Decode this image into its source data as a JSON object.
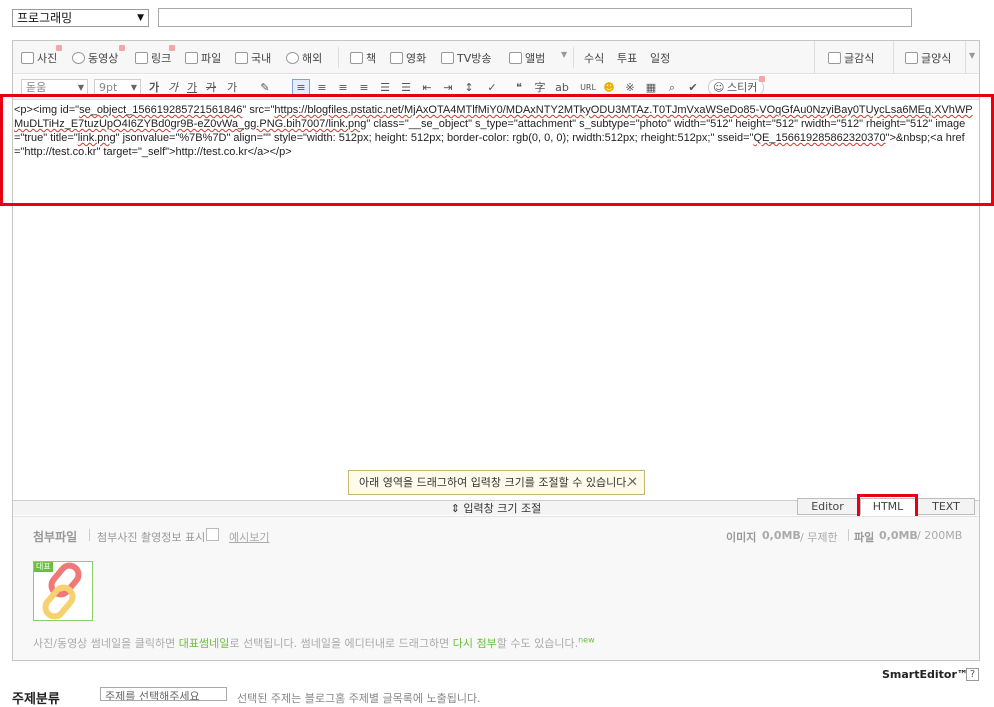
{
  "category": {
    "selected": "프로그래밍"
  },
  "title_input": {
    "value": ""
  },
  "toolbar1": {
    "photo": "사진",
    "video": "동영상",
    "link": "링크",
    "file": "파일",
    "domestic": "국내",
    "overseas": "해외",
    "book": "책",
    "movie": "영화",
    "tv": "TV방송",
    "album": "앨범",
    "formula": "수식",
    "vote": "투표",
    "schedule": "일정",
    "quote": "글감식",
    "style": "글양식"
  },
  "toolbar2": {
    "font": "돋움",
    "size": "9pt",
    "sticker": "스티커",
    "btn_bold": "가",
    "btn_italic": "가",
    "btn_underline": "가",
    "btn_strike": "가",
    "btn_color": "가"
  },
  "code": {
    "p_open": "<p>",
    "img_open": "<img id=\"",
    "img_id": "se_object_156619285721561846",
    "src_attr": "\" src=\"",
    "src_url": "https://blogfiles.pstatic.net/MjAxOTA4MTlfMiY0/MDAxNTY2MTkyODU3MTAz.T0TJmVxaWSeDo85-VOqGfAu0NzyiBay0TUycLsa6MEq.XVhWPMuDLTiHz_E7tuzUpO4I6ZYBd0gr9B-eZ0vWa_gg.PNG.bih7007/link.png",
    "class_attr": "\" class=\"__se_object\" s_type=\"attachment\" s_subtype=\"photo\" width=\"512\" height=\"512\" rwidth=\"512\" rheight=\"512\" ",
    "image_attr": "image=\"true\" title=\"",
    "title_val": "link.png",
    "jsonvalue_attr": "\" jsonvalue=\"%7B%7D\" align=\"\" style=\"width: 512px; height: 512px; border-color: rgb(0, 0, 0); rwidth:512px; rheight:512px;\" sseid=\"",
    "sseid_val": "QE_156619285862320370",
    "tail": "\">&nbsp;<a href=\"http://test.co.kr\" target=\"_self\">http://test.co.kr</a></p>"
  },
  "tooltip": "아래 영역을 드래그하여 입력창 크기를 조절할 수 있습니다.",
  "resize_label": "⇕ 입력창 크기 조절",
  "modes": {
    "editor": "Editor",
    "html": "HTML",
    "text": "TEXT"
  },
  "attach": {
    "title": "첨부파일",
    "exif": "첨부사진 촬영정보 표시",
    "example": "예시보기",
    "image_label": "이미지",
    "image_size": "0,0MB",
    "image_limit": "/ 무제한",
    "file_label": "파일",
    "file_size": "0,0MB",
    "file_limit": "/ 200MB",
    "thumb_badge": "대표",
    "help_1": "사진/동영상 썸네일을 클릭하면 ",
    "help_rep": "대표썸네일",
    "help_2": "로 선택됩니다.  썸네일을 에디터내로 드래그하면 ",
    "help_reattach": "다시 첨부",
    "help_3": "할 수도 있습니다.",
    "help_new": "new"
  },
  "footer": {
    "smarteditor": "SmartEditor™",
    "help": "?"
  },
  "topic": {
    "label": "주제분류",
    "select": "주제를 선택해주세요",
    "hint": "선택된 주제는 블로그홈 주제별 글목록에 노출됩니다."
  }
}
